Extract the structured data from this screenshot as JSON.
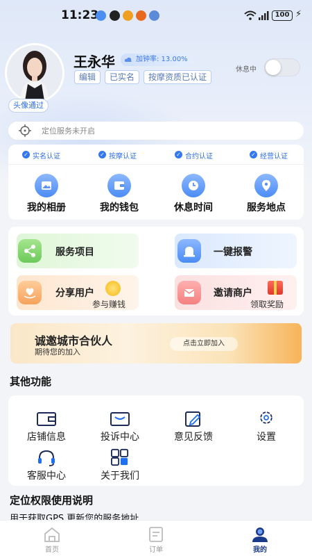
{
  "status_bar": {
    "time": "11:23",
    "battery": "100"
  },
  "profile": {
    "name": "王永华",
    "rate_label": "加钟率: 13.00%",
    "avatar_badge": "头像通过",
    "tags": [
      "编辑",
      "已实名",
      "按摩资质已认证"
    ],
    "rest_label": "休息中",
    "rest_toggle_on": false
  },
  "location": {
    "placeholder": "定位服务未开启"
  },
  "verifications": [
    "实名认证",
    "按摩认证",
    "合约认证",
    "经营认证"
  ],
  "quick_actions": [
    {
      "label": "我的相册",
      "icon": "album-icon"
    },
    {
      "label": "我的钱包",
      "icon": "wallet-icon"
    },
    {
      "label": "休息时间",
      "icon": "clock-icon"
    },
    {
      "label": "服务地点",
      "icon": "location-pin-icon"
    }
  ],
  "features": {
    "service": "服务项目",
    "alarm": "一键报警",
    "share": "分享用户",
    "share_sub": "参与赚钱",
    "invite": "邀请商户",
    "invite_sub": "领取奖励"
  },
  "banner": {
    "title": "诚邀城市合伙人",
    "subtitle": "期待您的加入",
    "button": "点击立即加入"
  },
  "other": {
    "title": "其他功能",
    "items": [
      {
        "label": "店铺信息",
        "icon": "store-icon"
      },
      {
        "label": "投诉中心",
        "icon": "mail-icon"
      },
      {
        "label": "意见反馈",
        "icon": "edit-icon"
      },
      {
        "label": "设置",
        "icon": "gear-icon"
      },
      {
        "label": "客服中心",
        "icon": "headset-icon"
      },
      {
        "label": "关于我们",
        "icon": "grid-icon"
      }
    ]
  },
  "location_notice": {
    "title": "定位权限使用说明",
    "text": "用于获取GPS,更新您的服务地址"
  },
  "tabs": [
    {
      "label": "首页",
      "icon": "home-icon",
      "active": false
    },
    {
      "label": "订单",
      "icon": "order-icon",
      "active": false
    },
    {
      "label": "我的",
      "icon": "user-icon",
      "active": true
    }
  ],
  "colors": {
    "accent": "#2f6fe0",
    "active_tab": "#1a3a8a",
    "inactive_tab": "#999999"
  }
}
